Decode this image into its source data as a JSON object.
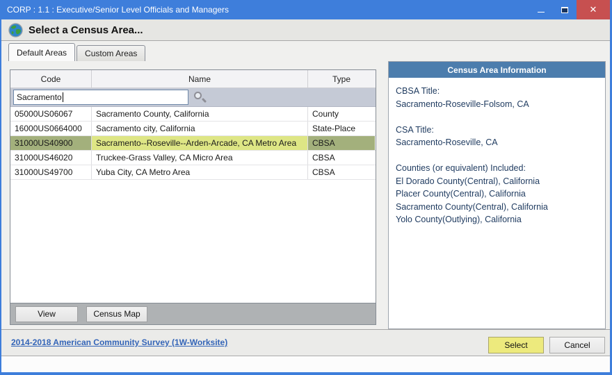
{
  "window": {
    "title": "CORP : 1.1 : Executive/Senior Level Officials and Managers",
    "close_glyph": "✕"
  },
  "dialog": {
    "heading": "Select a Census Area..."
  },
  "tabs": [
    {
      "label": "Default Areas"
    },
    {
      "label": "Custom Areas"
    }
  ],
  "table": {
    "columns": [
      "Code",
      "Name",
      "Type"
    ],
    "search_value": "Sacramento",
    "rows": [
      {
        "code": "05000US06067",
        "name": "Sacramento County, California",
        "type": "County"
      },
      {
        "code": "16000US0664000",
        "name": "Sacramento city, California",
        "type": "State-Place"
      },
      {
        "code": "31000US40900",
        "name": "Sacramento--Roseville--Arden-Arcade, CA Metro Area",
        "type": "CBSA"
      },
      {
        "code": "31000US46020",
        "name": "Truckee-Grass Valley, CA Micro Area",
        "type": "CBSA"
      },
      {
        "code": "31000US49700",
        "name": "Yuba City, CA Metro Area",
        "type": "CBSA"
      }
    ],
    "selected_row_index": 2,
    "footer_buttons": {
      "view": "View",
      "census_map": "Census Map"
    }
  },
  "info_panel": {
    "title": "Census Area Information",
    "lines": [
      "CBSA Title:",
      "Sacramento-Roseville-Folsom, CA",
      "",
      "CSA Title:",
      "Sacramento-Roseville, CA",
      "",
      "Counties (or equivalent) Included:",
      "El Dorado County(Central), California",
      "Placer County(Central), California",
      "Sacramento County(Central), California",
      "Yolo County(Outlying), California"
    ]
  },
  "footer": {
    "link": "2014-2018 American Community Survey (1W-Worksite)",
    "select_label": "Select",
    "cancel_label": "Cancel"
  },
  "colors": {
    "titlebar": "#3E7EDB",
    "close_button": "#C75050",
    "info_header": "#4C7DAD",
    "selected_row_olive": "#A3B07C",
    "selected_row_yellow": "#DEE685",
    "select_button": "#EDEA7D",
    "link": "#3465B8",
    "filter_row": "#C5CAD6"
  }
}
